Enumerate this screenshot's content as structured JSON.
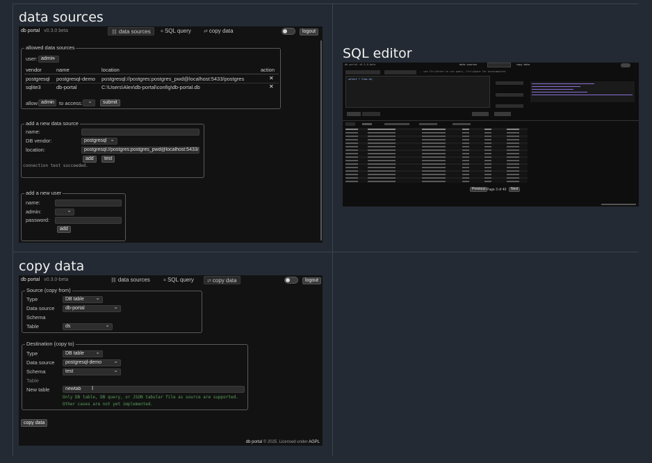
{
  "sections": {
    "data_sources_title": "data sources",
    "sql_editor_title": "SQL editor",
    "copy_data_title": "copy data"
  },
  "app": {
    "brand": "db portal",
    "version_a": "v0.3.0 beta",
    "version_b": "v0.3.0-beta",
    "tabs": {
      "data_sources": "data sources",
      "sql_query": "SQL query",
      "copy_data": "copy data"
    },
    "logout": "logout",
    "footer_brand": "db portal",
    "footer_year": "© 2025. Licensed under",
    "footer_license": "AGPL"
  },
  "ds": {
    "allowed": {
      "legend": "allowed data sources",
      "user_label": "user:",
      "user_value": "admin",
      "columns": [
        "vendor",
        "name",
        "location",
        "action"
      ],
      "rows": [
        {
          "vendor": "postgresql",
          "name": "postgresql-demo",
          "location": "postgresql://postgres:postgres_pwd@localhost:5433/postgres"
        },
        {
          "vendor": "sqlite3",
          "name": "db-portal",
          "location": "C:\\Users\\Alex\\db-portal\\config\\db-portal.db"
        }
      ],
      "allow_label": "allow",
      "allow_value": "admin",
      "to_access": "to access:",
      "submit": "submit"
    },
    "new_source": {
      "legend": "add a new data source",
      "name_label": "name:",
      "vendor_label": "DB vendor:",
      "vendor_value": "postgresql",
      "location_label": "location:",
      "location_value": "postgresql://postgres:postgres_pwd@localhost:5433/",
      "add": "add",
      "test": "test",
      "status": "connection test succeeded."
    },
    "new_user": {
      "legend": "add a new user",
      "name_label": "name:",
      "admin_label": "admin:",
      "password_label": "password:",
      "add": "add"
    }
  },
  "cp": {
    "source": {
      "legend": "Source (copy from)",
      "type_label": "Type",
      "type_value": "DB table",
      "ds_label": "Data source",
      "ds_value": "db-portal",
      "schema_label": "Schema",
      "table_label": "Table",
      "table_value": "ds"
    },
    "dest": {
      "legend": "Destination (copy to)",
      "type_label": "Type",
      "type_value": "DB table",
      "ds_label": "Data source",
      "ds_value": "postgresql-demo",
      "schema_label": "Schema",
      "schema_value": "test",
      "table_label": "Table",
      "newtable_label": "New table",
      "newtable_value": "newtab",
      "note1": "Only DB table, DB query, or JSON tabular file as source are supported.",
      "note2": "Other cases are not yet implemented."
    },
    "copy_btn": "copy data"
  },
  "sql": {
    "pagination": {
      "prev": "Previous",
      "page": "Page 3 of 40",
      "next": "Next"
    }
  }
}
